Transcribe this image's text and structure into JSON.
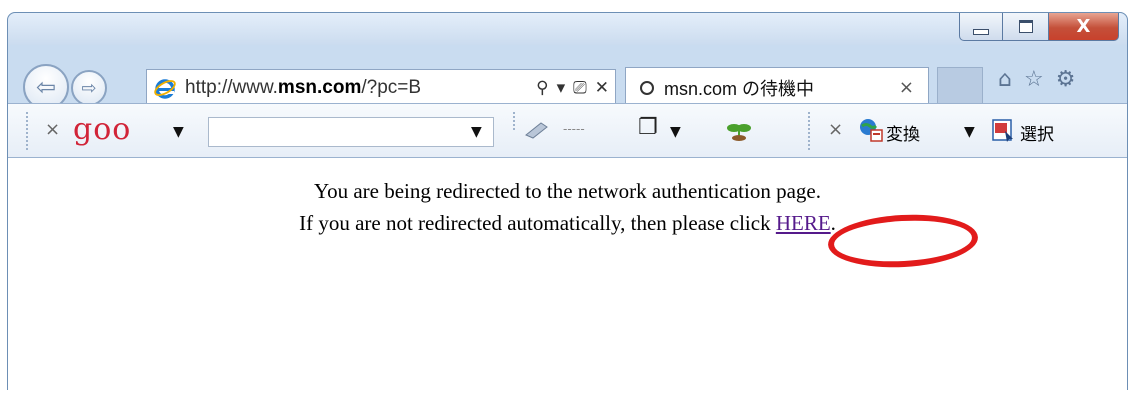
{
  "browser": {
    "address": {
      "prefix": "http://www.",
      "domain": "msn.com",
      "suffix": "/?pc=B"
    },
    "tab": {
      "label": "msn.com の待機中",
      "close": "×"
    },
    "controls": {
      "back": "⇦",
      "forward": "⇨",
      "minimize": "",
      "maximize": "",
      "close": "X"
    },
    "address_icons": {
      "search": "⚲",
      "dropdown": "▾",
      "compat": "⎚",
      "stop": "✕"
    },
    "right_icons": {
      "home": "⌂",
      "favorites": "☆",
      "tools": "⚙"
    }
  },
  "toolbar": {
    "close1": "×",
    "logo": "goo",
    "caret1": "▼",
    "caret2": "▼",
    "dots": "-----",
    "page_icon": "❐",
    "caret3": "▼",
    "close2": "×",
    "convert_label": "変換",
    "caret4": "▼",
    "select_label": "選択"
  },
  "content": {
    "line1": "You are being redirected to the network authentication page.",
    "line2_prefix": "If you are not redirected automatically, then please click ",
    "link": "HERE",
    "line2_suffix": "."
  },
  "colors": {
    "link": "#551a8b",
    "highlight_ring": "#e21b1b",
    "goo_logo": "#d12438"
  }
}
